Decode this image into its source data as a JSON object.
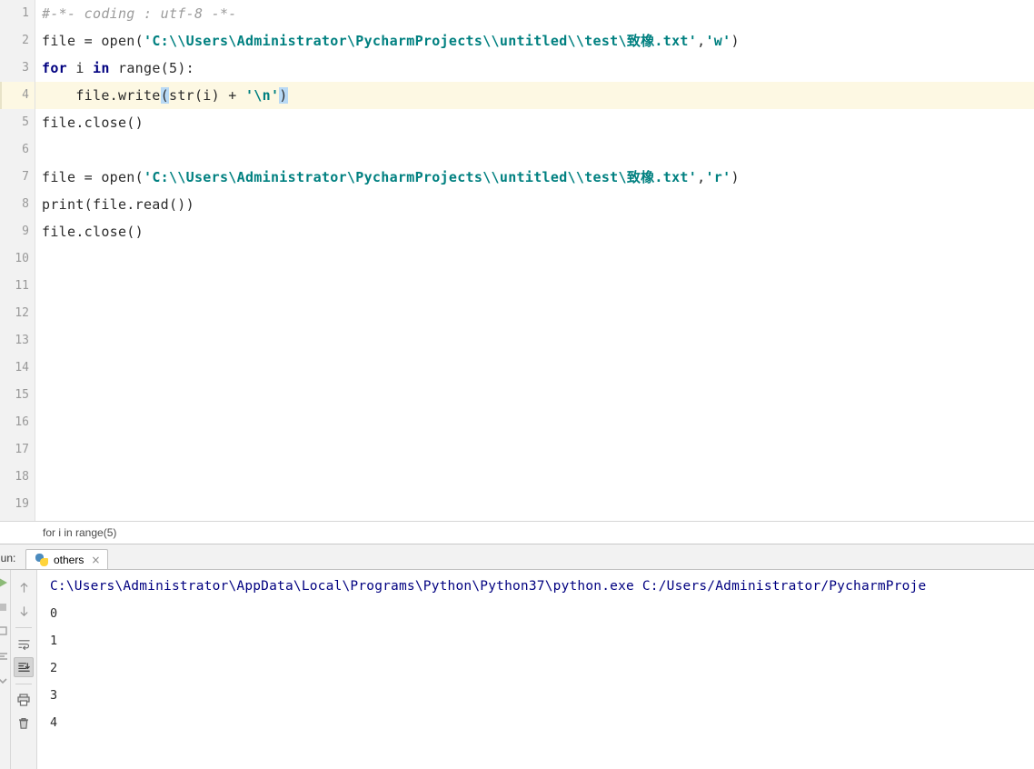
{
  "editor": {
    "line_numbers": [
      "1",
      "2",
      "3",
      "4",
      "5",
      "6",
      "7",
      "8",
      "9",
      "10",
      "11",
      "12",
      "13",
      "14",
      "15",
      "16",
      "17",
      "18",
      "19"
    ],
    "current_line": 4,
    "lines": [
      {
        "n": "1",
        "text": "#-*- coding : utf-8 -*-"
      },
      {
        "n": "2",
        "text": "file = open('C:\\\\Users\\Administrator\\PycharmProjects\\\\untitled\\\\test\\致橡.txt','w')"
      },
      {
        "n": "3",
        "text": "for i in range(5):"
      },
      {
        "n": "4",
        "text": "    file.write(str(i) + '\\n')"
      },
      {
        "n": "5",
        "text": "file.close()"
      },
      {
        "n": "6",
        "text": ""
      },
      {
        "n": "7",
        "text": "file = open('C:\\\\Users\\Administrator\\PycharmProjects\\\\untitled\\\\test\\致橡.txt','r')"
      },
      {
        "n": "8",
        "text": "print(file.read())"
      },
      {
        "n": "9",
        "text": "file.close()"
      }
    ],
    "tokens": {
      "l1_comment": "#-*- coding : utf-8 -*-",
      "l2_a": "file = open(",
      "l2_str": "'C:\\\\Users\\Administrator\\PycharmProjects\\\\untitled\\\\test\\致橡.txt'",
      "l2_comma": ",",
      "l2_mode": "'w'",
      "l2_close": ")",
      "l3_for": "for",
      "l3_i": " i ",
      "l3_in": "in",
      "l3_rest": " range(5):",
      "l4_indent": "    file.write",
      "l4_open_brace": "(",
      "l4_mid": "str(i) + ",
      "l4_str": "'\\n'",
      "l4_close_brace": ")",
      "l5_text": "file.close()",
      "l7_a": "file = open(",
      "l7_str": "'C:\\\\Users\\Administrator\\PycharmProjects\\\\untitled\\\\test\\致橡.txt'",
      "l7_comma": ",",
      "l7_mode": "'r'",
      "l7_close": ")",
      "l8_text": "print(file.read())",
      "l9_text": "file.close()"
    }
  },
  "breadcrumb": {
    "text": "for i in range(5)"
  },
  "run_panel": {
    "label": "Run:",
    "tab_name": "others",
    "tab_close": "×",
    "toolbar": [
      {
        "name": "up-arrow-icon",
        "active": false
      },
      {
        "name": "down-arrow-icon",
        "active": false
      },
      {
        "name": "soft-wrap-icon",
        "active": false
      },
      {
        "name": "scroll-to-end-icon",
        "active": true
      },
      {
        "name": "print-icon",
        "active": false
      },
      {
        "name": "trash-icon",
        "active": false
      }
    ],
    "console": {
      "command": "C:\\Users\\Administrator\\AppData\\Local\\Programs\\Python\\Python37\\python.exe C:/Users/Administrator/PycharmProje",
      "output": [
        "0",
        "1",
        "2",
        "3",
        "4"
      ]
    }
  },
  "colors": {
    "string": "#008080",
    "keyword": "#000080",
    "comment": "#9b9b9b",
    "number": "#0000ff",
    "current_line_bg": "#fdf8e3",
    "brace_match": "#b8d9f5",
    "console_command": "#000080",
    "gutter_bg": "#f2f2f2"
  }
}
